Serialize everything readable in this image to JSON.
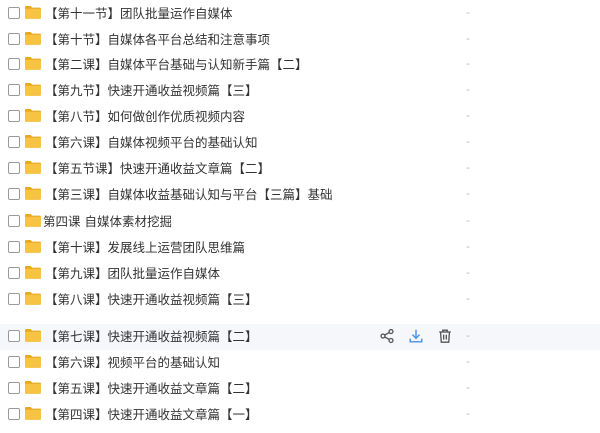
{
  "folders": [
    {
      "name": "【第十一节】团队批量运作自媒体",
      "size": "-"
    },
    {
      "name": "【第十节】自媒体各平台总结和注意事项",
      "size": "-"
    },
    {
      "name": "【第二课】自媒体平台基础与认知新手篇【二】",
      "size": "-"
    },
    {
      "name": "【第九节】快速开通收益视频篇【三】",
      "size": "-"
    },
    {
      "name": "【第八节】如何做创作优质视频内容",
      "size": "-"
    },
    {
      "name": "【第六课】自媒体视频平台的基础认知",
      "size": "-"
    },
    {
      "name": "【第五节课】快速开通收益文章篇【二】",
      "size": "-"
    },
    {
      "name": "【第三课】自媒体收益基础认知与平台【三篇】基础",
      "size": "-"
    },
    {
      "name": "第四课 自媒体素材挖掘",
      "size": "-"
    },
    {
      "name": "【第十课】发展线上运营团队思维篇",
      "size": "-"
    },
    {
      "name": "【第九课】团队批量运作自媒体",
      "size": "-"
    },
    {
      "name": "【第八课】快速开通收益视频篇【三】",
      "size": "-"
    },
    {
      "name": "【第七课】快速开通收益视频篇【二】",
      "size": "-",
      "hovered": true
    },
    {
      "name": "【第六课】视频平台的基础认知",
      "size": "-"
    },
    {
      "name": "【第五课】快速开通收益文章篇【二】",
      "size": "-"
    },
    {
      "name": "【第四课】快速开通收益文章篇【一】",
      "size": "-"
    }
  ],
  "row_actions": [
    "share-icon",
    "download-icon",
    "delete-icon"
  ],
  "colors": {
    "folder": "#f6c343",
    "folder_dark": "#e7a91f",
    "action_icon": "#555555",
    "download_icon": "#4a8fe7",
    "hover_bg": "#f5f7fb"
  }
}
